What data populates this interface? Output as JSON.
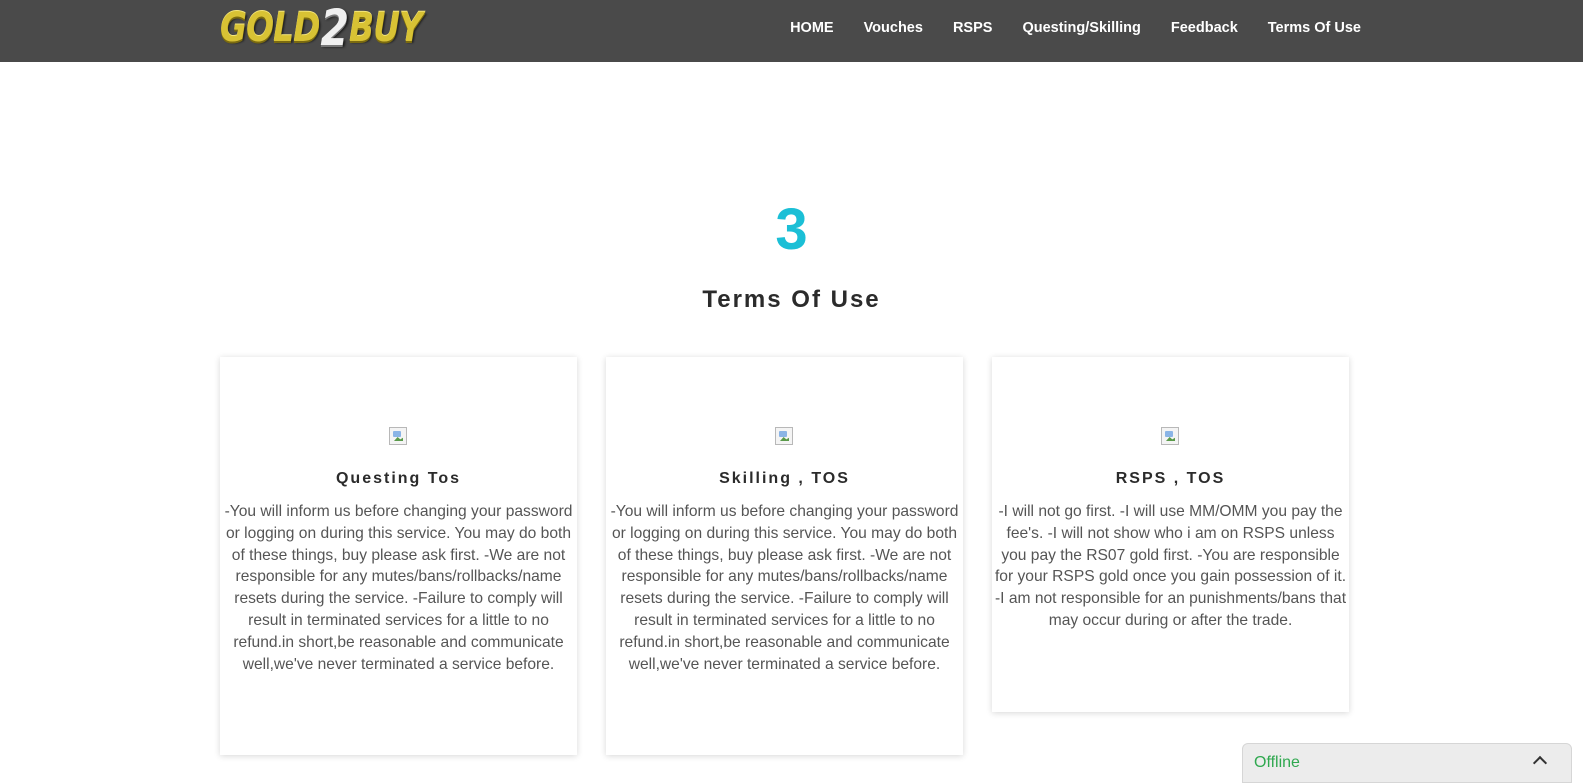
{
  "header": {
    "logo": {
      "part1": "GOLD",
      "part2": "2",
      "part3": "BUY"
    },
    "nav": [
      "HOME",
      "Vouches",
      "RSPS",
      "Questing/Skilling",
      "Feedback",
      "Terms Of Use"
    ]
  },
  "section": {
    "counter": "3",
    "title": "Terms Of Use"
  },
  "cards": [
    {
      "title": "Questing Tos",
      "text": "-You will inform us before changing your password or logging on during this service. You may do both of these things, buy please ask first. -We are not responsible for any mutes/bans/rollbacks/name resets during the service. -Failure to comply will result in terminated services for a little to no refund.in short,be reasonable and communicate well,we've never terminated a service before."
    },
    {
      "title": "Skilling , TOS",
      "text": "-You will inform us before changing your password or logging on during this service. You may do both of these things, buy please ask first. -We are not responsible for any mutes/bans/rollbacks/name resets during the service. -Failure to comply will result in terminated services for a little to no refund.in short,be reasonable and communicate well,we've never terminated a service before."
    },
    {
      "title": "RSPS , TOS",
      "text": "-I will not go first. -I will use MM/OMM you pay the fee's. -I will not show who i am on RSPS unless you pay the RS07 gold first. -You are responsible for your RSPS gold once you gain possession of it. -I am not responsible for an punishments/bans that may occur during or after the trade."
    }
  ],
  "chat_widget": {
    "status": "Offline",
    "icon": "chevron-up-icon"
  }
}
